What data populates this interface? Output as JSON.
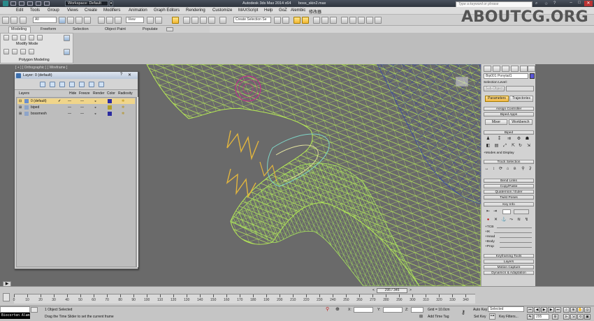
{
  "window": {
    "app_title": "Autodesk 3ds Max  2014 x64",
    "file": "boss_skin2.max",
    "workspace": "Workspace: Default",
    "search_placeholder": "Type a keyword or phrase"
  },
  "menu": [
    "Edit",
    "Tools",
    "Group",
    "Views",
    "Create",
    "Modifiers",
    "Animation",
    "Graph Editors",
    "Rendering",
    "Customize",
    "MAXScript",
    "Help",
    "GoZ",
    "Alembic",
    "修改器"
  ],
  "toolbar": {
    "filter": "All",
    "view": "View",
    "selection_set": "Create Selection Se"
  },
  "brand": "ABOUTCG.ORG",
  "ribbon": {
    "tabs": [
      "Modeling",
      "Freeform",
      "Selection",
      "Object Paint",
      "Populate"
    ],
    "mode_label": "Modify Mode",
    "group_label": "Polygon Modeling"
  },
  "viewport": {
    "label": "[ + ] [ Orthographic ] [ Wireframe ]"
  },
  "layer_window": {
    "title": "Layer: 0 (default)",
    "headers": [
      "Layers",
      "Hide",
      "Freeze",
      "Render",
      "Color",
      "Radiosity"
    ],
    "rows": [
      {
        "name": "0 (default)",
        "color": "#2a2aa8",
        "active": true
      },
      {
        "name": "biped",
        "color": "#b2a12a",
        "active": false
      },
      {
        "name": "bossmesh",
        "color": "#2b2ba0",
        "active": false
      }
    ]
  },
  "command_panel": {
    "object_name": "Bip001 Ponytail1",
    "selection_level": "Selection Level:",
    "sub_object": "Sub-Object",
    "tabs": [
      "Parameters",
      "Trajectories"
    ],
    "rollouts": [
      "Assign Controller",
      "Biped Apps"
    ],
    "buttons": [
      "Mixer",
      "Workbench"
    ],
    "biped_label": "Biped",
    "modes_label": "+Modes and Display",
    "track_selection": "Track Selection",
    "more_rollouts": [
      "Bend Links",
      "Copy/Paste",
      "Quaternion / Euler",
      "Twist Poses",
      "Key Info"
    ],
    "key_fields": [
      "+TCB",
      "+IK",
      "+Head",
      "+Body",
      "+Prop"
    ],
    "bottom_rollouts": [
      "Keyframing Tools",
      "Layers",
      "Motion Capture",
      "Dynamics & Adaptation"
    ]
  },
  "timeline": {
    "frame_display": "295 / 345",
    "ticks": [
      0,
      10,
      20,
      30,
      40,
      50,
      60,
      70,
      80,
      90,
      100,
      110,
      120,
      130,
      140,
      150,
      160,
      170,
      180,
      190,
      200,
      210,
      220,
      230,
      240,
      250,
      260,
      270,
      280,
      290,
      300,
      310,
      320,
      330,
      340
    ]
  },
  "status": {
    "maxscript": "Biocorten Alam",
    "selected": "1 Object Selected",
    "prompt": "Drag the Time Slider to set the current frame",
    "x_label": "X:",
    "y_label": "Y:",
    "z_label": "Z:",
    "grid": "Grid = 10.0cm",
    "add_time_tag": "Add Time Tag",
    "auto_key": "Auto Key",
    "set_key": "Set Key",
    "selected_dropdown": "Selected",
    "key_filters": "Key Filters...",
    "frame": "295"
  }
}
